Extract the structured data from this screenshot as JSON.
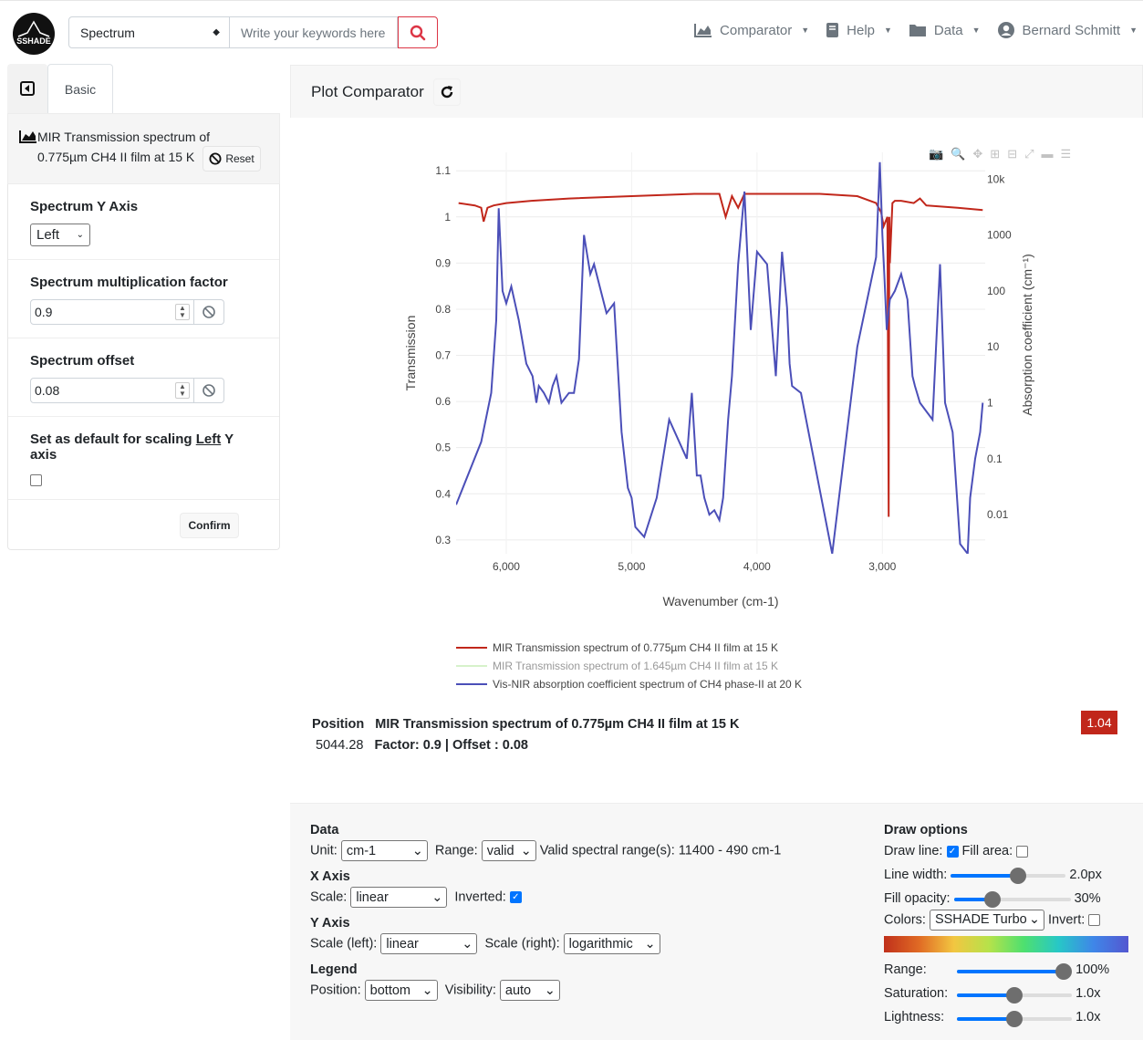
{
  "header": {
    "logo_text": "SSHADE",
    "search_type": "Spectrum",
    "search_placeholder": "Write your keywords here",
    "nav": [
      {
        "label": "Comparator",
        "icon": "area-chart-icon"
      },
      {
        "label": "Help",
        "icon": "book-icon"
      },
      {
        "label": "Data",
        "icon": "folder-icon"
      },
      {
        "label": "Bernard Schmitt",
        "icon": "user-icon"
      }
    ]
  },
  "left_panel": {
    "tab_label": "Basic",
    "spectrum_title": "MIR Transmission spectrum of 0.775µm CH4 II film at 15 K",
    "reset_label": "Reset",
    "y_axis_label": "Spectrum Y Axis",
    "y_axis_value": "Left",
    "mult_label": "Spectrum multiplication factor",
    "mult_value": "0.9",
    "offset_label": "Spectrum offset",
    "offset_value": "0.08",
    "default_label_pre": "Set as default for scaling ",
    "default_label_link": "Left",
    "default_label_post": " Y axis",
    "confirm_label": "Confirm"
  },
  "plot_panel": {
    "title": "Plot Comparator",
    "position_label": "Position",
    "position_value": "5044.28",
    "position_spectrum": "MIR Transmission spectrum of 0.775µm CH4 II film at 15 K",
    "factor_text": "Factor: 0.9 | Offset : 0.08",
    "badge_value": "1.04",
    "badge_color": "#c1271b"
  },
  "chart_data": {
    "type": "line",
    "xlabel": "Wavenumber (cm-1)",
    "ylabel_left": "Transmission",
    "ylabel_right": "Absorption coefficient (cm⁻¹)",
    "x_inverted": true,
    "x_scale": "linear",
    "y_left_scale": "linear",
    "y_right_scale": "logarithmic",
    "x_ticks": [
      6000,
      5000,
      4000,
      3000
    ],
    "y_left_ticks": [
      0.3,
      0.4,
      0.5,
      0.6,
      0.7,
      0.8,
      0.9,
      1,
      1.1
    ],
    "y_right_ticks": [
      0.01,
      0.1,
      1,
      10,
      100,
      1000,
      10000
    ],
    "y_right_tick_labels": [
      "0.01",
      "0.1",
      "1",
      "10",
      "100",
      "1000",
      "10k"
    ],
    "xlim": [
      6400,
      2180
    ],
    "ylim_left": [
      0.27,
      1.14
    ],
    "ylim_right": [
      0.002,
      30000
    ],
    "legend_position": "bottom",
    "series": [
      {
        "name": "MIR Transmission spectrum of 0.775µm CH4 II film at 15 K",
        "color": "#c1271b",
        "axis": "left",
        "x": [
          6380,
          6250,
          6200,
          6180,
          6150,
          6100,
          6000,
          5800,
          5500,
          5000,
          4500,
          4300,
          4250,
          4200,
          4150,
          4100,
          3800,
          3500,
          3200,
          3050,
          3010,
          2990,
          2960,
          2950,
          2945,
          2940,
          2920,
          2900,
          2850,
          2750,
          2700,
          2650,
          2400,
          2200
        ],
        "y": [
          1.03,
          1.025,
          1.02,
          0.99,
          1.02,
          1.025,
          1.03,
          1.035,
          1.04,
          1.045,
          1.05,
          1.05,
          1.0,
          1.045,
          1.02,
          1.05,
          1.05,
          1.05,
          1.045,
          1.03,
          1.01,
          0.98,
          1.0,
          0.35,
          1.0,
          0.9,
          1.03,
          1.035,
          1.035,
          1.03,
          1.04,
          1.025,
          1.02,
          1.015
        ]
      },
      {
        "name": "MIR Transmission spectrum of 1.645µm CH4 II film at 15 K",
        "color": "#b5e8a0",
        "axis": "left",
        "x": [],
        "y": []
      },
      {
        "name": "Vis-NIR absorption coefficient spectrum of CH4 phase-II at 20 K",
        "color": "#4b4fb8",
        "axis": "right",
        "x": [
          6400,
          6200,
          6120,
          6080,
          6060,
          6030,
          6000,
          5960,
          5900,
          5840,
          5790,
          5760,
          5740,
          5700,
          5660,
          5630,
          5600,
          5560,
          5500,
          5460,
          5420,
          5380,
          5330,
          5300,
          5200,
          5140,
          5080,
          5030,
          5000,
          4970,
          4900,
          4800,
          4700,
          4560,
          4520,
          4480,
          4450,
          4420,
          4380,
          4340,
          4300,
          4270,
          4230,
          4200,
          4150,
          4100,
          4050,
          4000,
          3920,
          3850,
          3800,
          3760,
          3740,
          3720,
          3650,
          3400,
          3200,
          3050,
          3020,
          3000,
          2985,
          2965,
          2940,
          2900,
          2850,
          2800,
          2760,
          2740,
          2700,
          2600,
          2540,
          2500,
          2440,
          2380,
          2320,
          2300,
          2260,
          2220,
          2200
        ],
        "y": [
          0.015,
          0.2,
          1.5,
          30,
          3000,
          100,
          60,
          120,
          30,
          5,
          3,
          1,
          2,
          1.5,
          1,
          2,
          3,
          1,
          1.5,
          1.5,
          6,
          1000,
          200,
          300,
          40,
          60,
          0.3,
          0.03,
          0.02,
          0.006,
          0.004,
          0.02,
          0.5,
          0.1,
          1.5,
          0.05,
          0.05,
          0.02,
          0.01,
          0.012,
          0.008,
          0.02,
          0.5,
          3,
          300,
          6000,
          20,
          500,
          300,
          3,
          500,
          50,
          5,
          2,
          1.5,
          0.002,
          10,
          400,
          20000,
          1000,
          200,
          20,
          70,
          100,
          200,
          70,
          3,
          2,
          1,
          0.5,
          300,
          1,
          0.3,
          0.003,
          0.002,
          0.02,
          0.1,
          0.3,
          1
        ]
      }
    ]
  },
  "controls": {
    "data_heading": "Data",
    "unit_label": "Unit:",
    "unit_value": "cm-1",
    "range_label": "Range:",
    "range_value": "valid",
    "valid_range_text": "Valid spectral range(s): 11400 - 490 cm-1",
    "xaxis_heading": "X Axis",
    "xscale_label": "Scale:",
    "xscale_value": "linear",
    "inverted_label": "Inverted:",
    "yaxis_heading": "Y Axis",
    "yscale_left_label": "Scale (left):",
    "yscale_left_value": "linear",
    "yscale_right_label": "Scale (right):",
    "yscale_right_value": "logarithmic",
    "legend_heading": "Legend",
    "legend_position_label": "Position:",
    "legend_position_value": "bottom",
    "legend_visibility_label": "Visibility:",
    "legend_visibility_value": "auto",
    "draw_heading": "Draw options",
    "draw_line_label": "Draw line:",
    "fill_area_label": "Fill area:",
    "line_width_label": "Line width:",
    "line_width_value": "2.0px",
    "line_width_fraction": 0.6,
    "fill_opacity_label": "Fill opacity:",
    "fill_opacity_value": "30%",
    "fill_opacity_fraction": 0.3,
    "colors_label": "Colors:",
    "colors_value": "SSHADE Turbo",
    "invert_label": "Invert:",
    "range_slider_label": "Range:",
    "range_slider_value": "100%",
    "range_slider_fraction": 1.0,
    "saturation_label": "Saturation:",
    "saturation_value": "1.0x",
    "saturation_fraction": 0.5,
    "lightness_label": "Lightness:",
    "lightness_value": "1.0x",
    "lightness_fraction": 0.5
  }
}
